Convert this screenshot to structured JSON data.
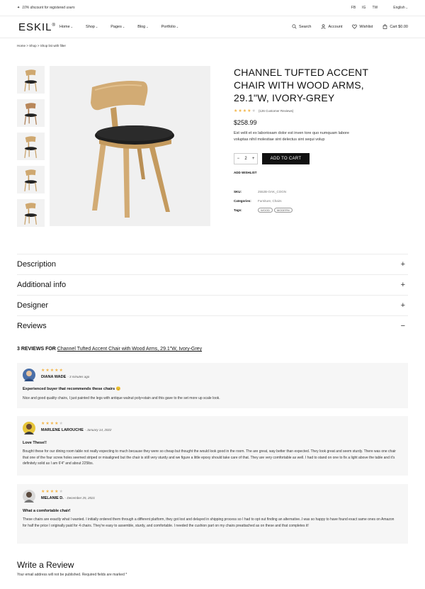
{
  "topbar": {
    "promo": "10% discount for registered users",
    "social": [
      "FB",
      "IG",
      "TW"
    ],
    "language": "English"
  },
  "header": {
    "logo": "ESKIL",
    "logo_mark": "®",
    "nav": [
      "Home",
      "Shop",
      "Pages",
      "Blog",
      "Portfolio"
    ],
    "search": "Search",
    "account": "Account",
    "wishlist": "Wishlist",
    "cart": "Cart $0.00"
  },
  "breadcrumb": "Home > Shop > Shop list with filter",
  "product": {
    "title": "CHANNEL TUFTED ACCENT CHAIR WITH WOOD ARMS, 29.1\"W, IVORY-GREY",
    "rating": 4,
    "rating_text": "(126 Customer Reviews)",
    "price": "$258.99",
    "description": "Est velit et ex laboriosam dolor est inven tore quo numquam labore voluptas nihil molestiae sint delectus sint sequi volup",
    "qty_minus": "−",
    "qty": "2",
    "qty_plus": "+",
    "add_to_cart": "ADD TO CART",
    "add_wishlist": "ADD WISHLIST",
    "sku_label": "SKU:",
    "sku": "2552B-OAK_COGN",
    "categories_label": "Categories:",
    "categories": "Furniture, Chairs",
    "tags_label": "Tags:",
    "tags": [
      "WOOD",
      "MODERN"
    ]
  },
  "accordion": [
    {
      "label": "Description",
      "sign": "+"
    },
    {
      "label": "Additional info",
      "sign": "+"
    },
    {
      "label": "Designer",
      "sign": "+"
    },
    {
      "label": "Reviews",
      "sign": "−"
    }
  ],
  "reviews_heading": {
    "prefix": "3 REVIEWS FOR",
    "link": "Channel Tufted Accent Chair with Wood Arms, 29.1\"W, Ivory-Grey"
  },
  "reviews": [
    {
      "name": "DIANA WADE",
      "date": "- 3 minutes ago",
      "stars": 5,
      "title": "Experienced buyer that recommends these chairs 😊",
      "body": "Nice and good quality chairs, I just painted the legs with antique walnut poly+stain and this gave to the set more up scale look."
    },
    {
      "name": "MARLENE LAROUCHE",
      "date": "- January 14, 2022",
      "stars": 4,
      "title": "Love These!!",
      "body": "Bought these for our dining room table not really expecting to much because they were so cheap but thought the would look good in the room. The are great, way better than expected. They look great and seem sturdy. There was one chair that one of the four screw holes seemed striped or misaligned but the chair is still very sturdy and we figure a little epoxy should take care of that. They are very comfortable as well. I had to stand on one to fix a light above the table and it's definitely solid as I am 6'4\" and about 225lbs."
    },
    {
      "name": "MELANIE D.",
      "date": "- December 25, 2021",
      "stars": 4,
      "title": "What a comfortable chair!",
      "body": "These chairs are exactly what I wanted. I initially ordered them through a different platform, they got lost and delayed in shipping process so I had to opt out finding an alternative..I was so happy to have found exact same ones on Amazon for half the price I originally paid for 4 chairs. They're easy to assemble, sturdy, and comfortable. I needed the cushion part on my chairs preattached as on these and that completes it!"
    }
  ],
  "write_review": {
    "title": "Write a Review",
    "note": "Your email address will not be published. Required fields are marked *"
  },
  "colors": {
    "accent_star": "#f2b54a",
    "button": "#111111",
    "review_bg": "#f6f6f6"
  }
}
